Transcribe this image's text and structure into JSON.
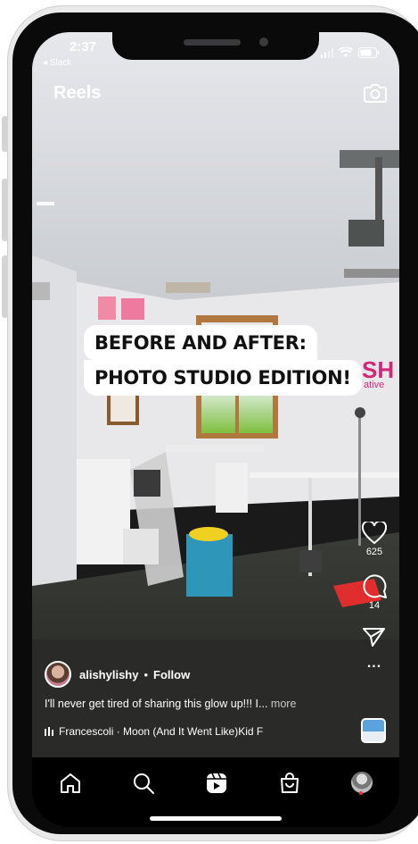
{
  "status_bar": {
    "time": "2:37",
    "back_app": "◂ Slack"
  },
  "header": {
    "title": "Reels",
    "camera_icon": "camera-icon"
  },
  "video": {
    "caption_line1": "BEFORE AND AFTER:",
    "caption_line2": "PHOTO STUDIO EDITION!",
    "wall_sign": "SH",
    "wall_sign_sub": "ative"
  },
  "actions": {
    "like_count": "625",
    "comment_count": "14",
    "more_label": "..."
  },
  "post": {
    "username": "alishylishy",
    "separator": "•",
    "follow_label": "Follow",
    "caption": "I'll never get tired of sharing this glow up!!! I...",
    "more_label": "more",
    "audio": "Francescoli · Moon (And It Went Like)Kid F"
  },
  "nav": {
    "items": [
      "home-icon",
      "search-icon",
      "reels-icon",
      "shop-icon",
      "profile-avatar"
    ]
  },
  "colors": {
    "accent_red": "#ff3040",
    "background": "#000000"
  }
}
